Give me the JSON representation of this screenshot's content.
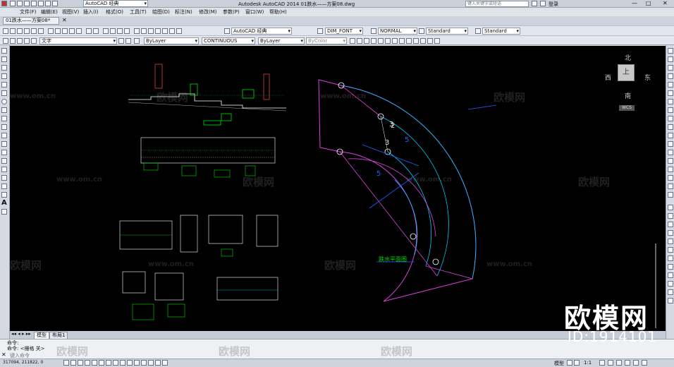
{
  "app": {
    "workspace": "AutoCAD 经典",
    "title": "Autodesk AutoCAD 2014    01跌水——方案08.dwg",
    "search_placeholder": "键入关键字或短语",
    "login": "登录"
  },
  "menu": [
    "文件(F)",
    "编辑(E)",
    "视图(V)",
    "插入(I)",
    "格式(O)",
    "工具(T)",
    "绘图(D)",
    "标注(N)",
    "修改(M)",
    "参数(P)",
    "窗口(W)",
    "帮助(H)"
  ],
  "file_tab": "01跌水——方案08*",
  "toolbar1": {
    "text_style": "AutoCAD 经典",
    "dim_style": "DIM_FONT",
    "plot_style": "NORMAL",
    "table_style": "Standard",
    "multileader_style": "Standard"
  },
  "toolbar2": {
    "layer": "文字",
    "color": "ByLayer",
    "linetype": "CONTINUOUS",
    "lineweight": "ByLayer",
    "plotstyle": "ByColor"
  },
  "viewcube": {
    "north": "北",
    "south": "南",
    "east": "东",
    "west": "西",
    "top": "上",
    "wcs": "WCS"
  },
  "drawing": {
    "plan_label": "跌水平面图",
    "dim_labels": [
      "3",
      "2",
      "5",
      "3",
      "5"
    ]
  },
  "layout_tabs": [
    "模型",
    "布局1"
  ],
  "command": {
    "line1": "命令:",
    "line2": "命令:   <栅格 关>",
    "prompt": "键入命令"
  },
  "status": {
    "coords": "317094, 211822, 0",
    "model": "模型",
    "scale": "1:1"
  },
  "watermark": {
    "site": "www.om.cn",
    "brand": "欧模网",
    "id": "ID:1914101"
  },
  "colors": {
    "canvas_bg": "#000000",
    "cyan": "#00c8ff",
    "magenta": "#e040e0",
    "green": "#00e000",
    "blue": "#2060ff",
    "white": "#ffffff"
  }
}
